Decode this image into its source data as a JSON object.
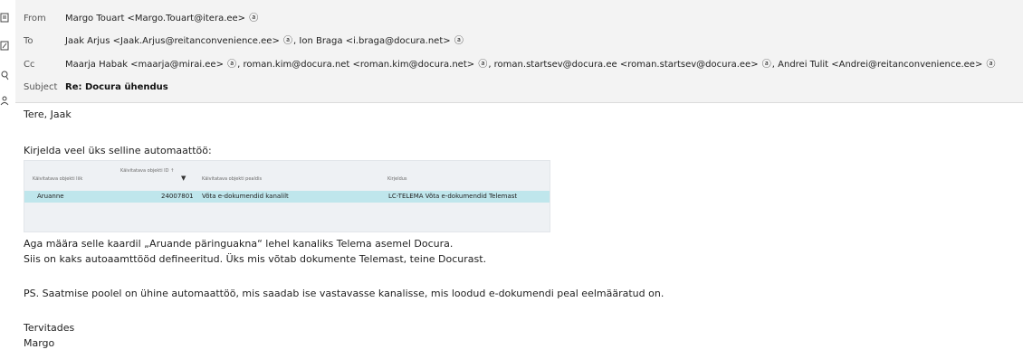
{
  "header": {
    "from_label": "From",
    "from_value": "Margo Touart <Margo.Touart@itera.ee>",
    "to_label": "To",
    "to_value_1": "Jaak Arjus <Jaak.Arjus@reitanconvenience.ee>",
    "to_value_2": ", Ion Braga <i.braga@docura.net>",
    "cc_label": "Cc",
    "cc_value_1": "Maarja Habak <maarja@mirai.ee>",
    "cc_value_2": ", roman.kim@docura.net <roman.kim@docura.net>",
    "cc_value_3": ", roman.startsev@docura.ee <roman.startsev@docura.ee>",
    "cc_value_4": ", Andrei Tulit <Andrei@reitanconvenience.ee>",
    "subject_label": "Subject",
    "subject_value": "Re: Docura ühendus",
    "contact_icon_glyph": "ⓐ"
  },
  "body": {
    "greeting": "Tere, Jaak",
    "intro": "Kirjelda veel üks selline automaattöö:",
    "p1_line1": "Aga määra selle kaardil „Aruande päringuakna“ lehel kanaliks Telema asemel Docura.",
    "p1_line2": "Siis on kaks autoaamttööd defineeritud. Üks mis võtab dokumente Telemast, teine Docurast.",
    "ps": "PS. Saatmise poolel on ühine automaattöö, mis saadab ise vastavasse kanalisse, mis loodud e-dokumendi peal eelmääratud on.",
    "closing": "Tervitades",
    "signature": "Margo"
  },
  "embedded_table": {
    "columns": [
      "Käivitatava objekti liik",
      "Käivitatava objekti ID ↑",
      "Käivitatava objekti pealdis",
      "Kirjeldus"
    ],
    "row": [
      "Aruanne",
      "24007801",
      "Võta e-dokumendid kanalilt",
      "LC-TELEMA Võta e-dokumendid Telemast"
    ],
    "filter_glyph": "▼"
  },
  "rail_icons": [
    "message-icon",
    "edit-icon",
    "search-person-icon",
    "person-icon"
  ]
}
